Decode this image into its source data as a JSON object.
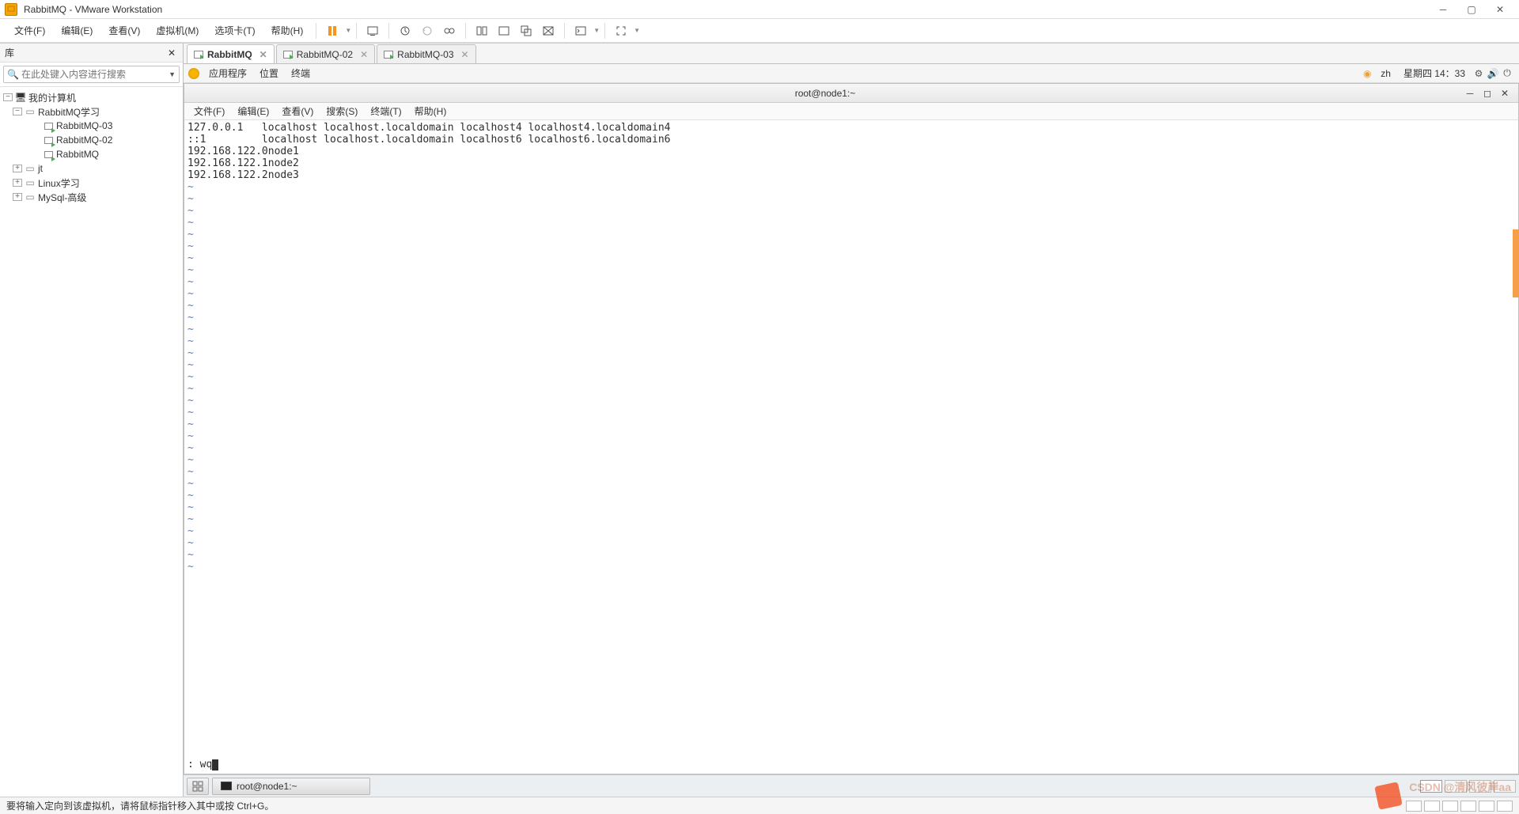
{
  "window": {
    "title": "RabbitMQ - VMware Workstation"
  },
  "menubar": {
    "file": "文件(F)",
    "edit": "编辑(E)",
    "view": "查看(V)",
    "vm": "虚拟机(M)",
    "tabs": "选项卡(T)",
    "help": "帮助(H)"
  },
  "sidebar": {
    "lib_title": "库",
    "search_placeholder": "在此处键入内容进行搜索",
    "tree": {
      "root": "我的计算机",
      "folders": [
        {
          "name": "RabbitMQ学习",
          "expanded": true,
          "vms": [
            "RabbitMQ-03",
            "RabbitMQ-02",
            "RabbitMQ"
          ]
        },
        {
          "name": "jt",
          "expanded": false
        },
        {
          "name": "Linux学习",
          "expanded": false
        },
        {
          "name": "MySql-高级",
          "expanded": false
        }
      ]
    }
  },
  "vm_tabs": [
    {
      "label": "RabbitMQ",
      "active": true
    },
    {
      "label": "RabbitMQ-02",
      "active": false
    },
    {
      "label": "RabbitMQ-03",
      "active": false
    }
  ],
  "gnome": {
    "applications": "应用程序",
    "places": "位置",
    "terminal": "终端",
    "lang": "zh",
    "clock": "星期四 14：33"
  },
  "terminal_window": {
    "title": "root@node1:~",
    "menu": {
      "file": "文件(F)",
      "edit": "编辑(E)",
      "view": "查看(V)",
      "search": "搜索(S)",
      "terminal": "终端(T)",
      "help": "帮助(H)"
    },
    "lines": [
      "127.0.0.1   localhost localhost.localdomain localhost4 localhost4.localdomain4",
      "::1         localhost localhost.localdomain localhost6 localhost6.localdomain6",
      "192.168.122.0node1",
      "192.168.122.1node2",
      "192.168.122.2node3"
    ],
    "cmd_prefix": ": ",
    "cmd": "wq"
  },
  "taskbar": {
    "item": "root@node1:~"
  },
  "status_bar": {
    "text": "要将输入定向到该虚拟机，请将鼠标指针移入其中或按 Ctrl+G。"
  },
  "watermark": "CSDN @清风彼岸aa"
}
